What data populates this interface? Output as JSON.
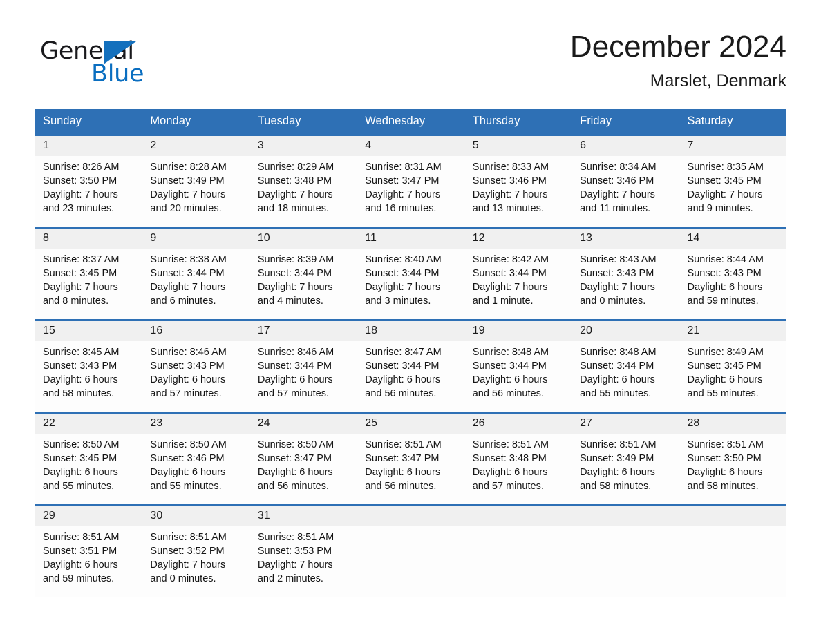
{
  "brand": {
    "name_part1": "General",
    "name_part2": "Blue",
    "triangle_color": "#1470bd",
    "blue_text_color": "#0a6ec0"
  },
  "header": {
    "title": "December 2024",
    "location": "Marslet, Denmark"
  },
  "theme": {
    "header_blue": "#2e70b5",
    "daynum_band": "#f0f0f0",
    "cell_background": "#fdfdfd",
    "text_color": "#151515"
  },
  "weekday_headers": [
    "Sunday",
    "Monday",
    "Tuesday",
    "Wednesday",
    "Thursday",
    "Friday",
    "Saturday"
  ],
  "labels": {
    "sunrise_prefix": "Sunrise:",
    "sunset_prefix": "Sunset:",
    "daylight_prefix": "Daylight:"
  },
  "weeks": [
    [
      {
        "day": "1",
        "sunrise": "Sunrise: 8:26 AM",
        "sunset": "Sunset: 3:50 PM",
        "daylight_line1": "Daylight: 7 hours",
        "daylight_line2": "and 23 minutes."
      },
      {
        "day": "2",
        "sunrise": "Sunrise: 8:28 AM",
        "sunset": "Sunset: 3:49 PM",
        "daylight_line1": "Daylight: 7 hours",
        "daylight_line2": "and 20 minutes."
      },
      {
        "day": "3",
        "sunrise": "Sunrise: 8:29 AM",
        "sunset": "Sunset: 3:48 PM",
        "daylight_line1": "Daylight: 7 hours",
        "daylight_line2": "and 18 minutes."
      },
      {
        "day": "4",
        "sunrise": "Sunrise: 8:31 AM",
        "sunset": "Sunset: 3:47 PM",
        "daylight_line1": "Daylight: 7 hours",
        "daylight_line2": "and 16 minutes."
      },
      {
        "day": "5",
        "sunrise": "Sunrise: 8:33 AM",
        "sunset": "Sunset: 3:46 PM",
        "daylight_line1": "Daylight: 7 hours",
        "daylight_line2": "and 13 minutes."
      },
      {
        "day": "6",
        "sunrise": "Sunrise: 8:34 AM",
        "sunset": "Sunset: 3:46 PM",
        "daylight_line1": "Daylight: 7 hours",
        "daylight_line2": "and 11 minutes."
      },
      {
        "day": "7",
        "sunrise": "Sunrise: 8:35 AM",
        "sunset": "Sunset: 3:45 PM",
        "daylight_line1": "Daylight: 7 hours",
        "daylight_line2": "and 9 minutes."
      }
    ],
    [
      {
        "day": "8",
        "sunrise": "Sunrise: 8:37 AM",
        "sunset": "Sunset: 3:45 PM",
        "daylight_line1": "Daylight: 7 hours",
        "daylight_line2": "and 8 minutes."
      },
      {
        "day": "9",
        "sunrise": "Sunrise: 8:38 AM",
        "sunset": "Sunset: 3:44 PM",
        "daylight_line1": "Daylight: 7 hours",
        "daylight_line2": "and 6 minutes."
      },
      {
        "day": "10",
        "sunrise": "Sunrise: 8:39 AM",
        "sunset": "Sunset: 3:44 PM",
        "daylight_line1": "Daylight: 7 hours",
        "daylight_line2": "and 4 minutes."
      },
      {
        "day": "11",
        "sunrise": "Sunrise: 8:40 AM",
        "sunset": "Sunset: 3:44 PM",
        "daylight_line1": "Daylight: 7 hours",
        "daylight_line2": "and 3 minutes."
      },
      {
        "day": "12",
        "sunrise": "Sunrise: 8:42 AM",
        "sunset": "Sunset: 3:44 PM",
        "daylight_line1": "Daylight: 7 hours",
        "daylight_line2": "and 1 minute."
      },
      {
        "day": "13",
        "sunrise": "Sunrise: 8:43 AM",
        "sunset": "Sunset: 3:43 PM",
        "daylight_line1": "Daylight: 7 hours",
        "daylight_line2": "and 0 minutes."
      },
      {
        "day": "14",
        "sunrise": "Sunrise: 8:44 AM",
        "sunset": "Sunset: 3:43 PM",
        "daylight_line1": "Daylight: 6 hours",
        "daylight_line2": "and 59 minutes."
      }
    ],
    [
      {
        "day": "15",
        "sunrise": "Sunrise: 8:45 AM",
        "sunset": "Sunset: 3:43 PM",
        "daylight_line1": "Daylight: 6 hours",
        "daylight_line2": "and 58 minutes."
      },
      {
        "day": "16",
        "sunrise": "Sunrise: 8:46 AM",
        "sunset": "Sunset: 3:43 PM",
        "daylight_line1": "Daylight: 6 hours",
        "daylight_line2": "and 57 minutes."
      },
      {
        "day": "17",
        "sunrise": "Sunrise: 8:46 AM",
        "sunset": "Sunset: 3:44 PM",
        "daylight_line1": "Daylight: 6 hours",
        "daylight_line2": "and 57 minutes."
      },
      {
        "day": "18",
        "sunrise": "Sunrise: 8:47 AM",
        "sunset": "Sunset: 3:44 PM",
        "daylight_line1": "Daylight: 6 hours",
        "daylight_line2": "and 56 minutes."
      },
      {
        "day": "19",
        "sunrise": "Sunrise: 8:48 AM",
        "sunset": "Sunset: 3:44 PM",
        "daylight_line1": "Daylight: 6 hours",
        "daylight_line2": "and 56 minutes."
      },
      {
        "day": "20",
        "sunrise": "Sunrise: 8:48 AM",
        "sunset": "Sunset: 3:44 PM",
        "daylight_line1": "Daylight: 6 hours",
        "daylight_line2": "and 55 minutes."
      },
      {
        "day": "21",
        "sunrise": "Sunrise: 8:49 AM",
        "sunset": "Sunset: 3:45 PM",
        "daylight_line1": "Daylight: 6 hours",
        "daylight_line2": "and 55 minutes."
      }
    ],
    [
      {
        "day": "22",
        "sunrise": "Sunrise: 8:50 AM",
        "sunset": "Sunset: 3:45 PM",
        "daylight_line1": "Daylight: 6 hours",
        "daylight_line2": "and 55 minutes."
      },
      {
        "day": "23",
        "sunrise": "Sunrise: 8:50 AM",
        "sunset": "Sunset: 3:46 PM",
        "daylight_line1": "Daylight: 6 hours",
        "daylight_line2": "and 55 minutes."
      },
      {
        "day": "24",
        "sunrise": "Sunrise: 8:50 AM",
        "sunset": "Sunset: 3:47 PM",
        "daylight_line1": "Daylight: 6 hours",
        "daylight_line2": "and 56 minutes."
      },
      {
        "day": "25",
        "sunrise": "Sunrise: 8:51 AM",
        "sunset": "Sunset: 3:47 PM",
        "daylight_line1": "Daylight: 6 hours",
        "daylight_line2": "and 56 minutes."
      },
      {
        "day": "26",
        "sunrise": "Sunrise: 8:51 AM",
        "sunset": "Sunset: 3:48 PM",
        "daylight_line1": "Daylight: 6 hours",
        "daylight_line2": "and 57 minutes."
      },
      {
        "day": "27",
        "sunrise": "Sunrise: 8:51 AM",
        "sunset": "Sunset: 3:49 PM",
        "daylight_line1": "Daylight: 6 hours",
        "daylight_line2": "and 58 minutes."
      },
      {
        "day": "28",
        "sunrise": "Sunrise: 8:51 AM",
        "sunset": "Sunset: 3:50 PM",
        "daylight_line1": "Daylight: 6 hours",
        "daylight_line2": "and 58 minutes."
      }
    ],
    [
      {
        "day": "29",
        "sunrise": "Sunrise: 8:51 AM",
        "sunset": "Sunset: 3:51 PM",
        "daylight_line1": "Daylight: 6 hours",
        "daylight_line2": "and 59 minutes."
      },
      {
        "day": "30",
        "sunrise": "Sunrise: 8:51 AM",
        "sunset": "Sunset: 3:52 PM",
        "daylight_line1": "Daylight: 7 hours",
        "daylight_line2": "and 0 minutes."
      },
      {
        "day": "31",
        "sunrise": "Sunrise: 8:51 AM",
        "sunset": "Sunset: 3:53 PM",
        "daylight_line1": "Daylight: 7 hours",
        "daylight_line2": "and 2 minutes."
      },
      {
        "day": "",
        "sunrise": "",
        "sunset": "",
        "daylight_line1": "",
        "daylight_line2": ""
      },
      {
        "day": "",
        "sunrise": "",
        "sunset": "",
        "daylight_line1": "",
        "daylight_line2": ""
      },
      {
        "day": "",
        "sunrise": "",
        "sunset": "",
        "daylight_line1": "",
        "daylight_line2": ""
      },
      {
        "day": "",
        "sunrise": "",
        "sunset": "",
        "daylight_line1": "",
        "daylight_line2": ""
      }
    ]
  ]
}
